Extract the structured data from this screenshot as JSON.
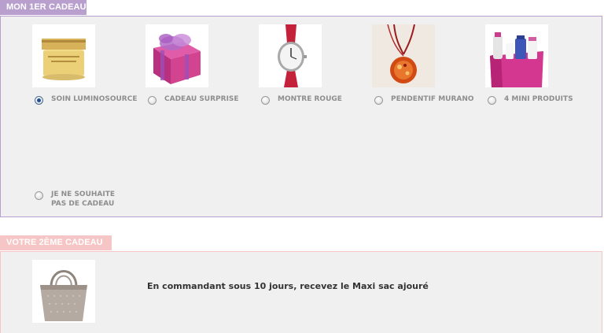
{
  "section1": {
    "title": "MON 1ER CADEAU",
    "options": [
      {
        "label": "SOIN LUMINOSOURCE",
        "image": "cream-jar-image",
        "selected": true
      },
      {
        "label": "CADEAU SURPRISE",
        "image": "gift-box-image",
        "selected": false
      },
      {
        "label": "MONTRE ROUGE",
        "image": "red-watch-image",
        "selected": false
      },
      {
        "label": "PENDENTIF MURANO",
        "image": "pendant-image",
        "selected": false
      },
      {
        "label": "4 MINI PRODUITS",
        "image": "mini-products-image",
        "selected": false
      }
    ],
    "no_gift": {
      "label": "JE NE SOUHAITE PAS DE CADEAU",
      "selected": false
    }
  },
  "section2": {
    "title": "VOTRE 2ÈME CADEAU",
    "image": "bag-image",
    "text": "En commandant sous 10 jours, recevez le Maxi sac ajouré"
  },
  "colors": {
    "section1_accent": "#b89fce",
    "section2_accent": "#f6c5c5",
    "panel_bg": "#f1f0f0",
    "label_text": "#8e8e8e"
  }
}
